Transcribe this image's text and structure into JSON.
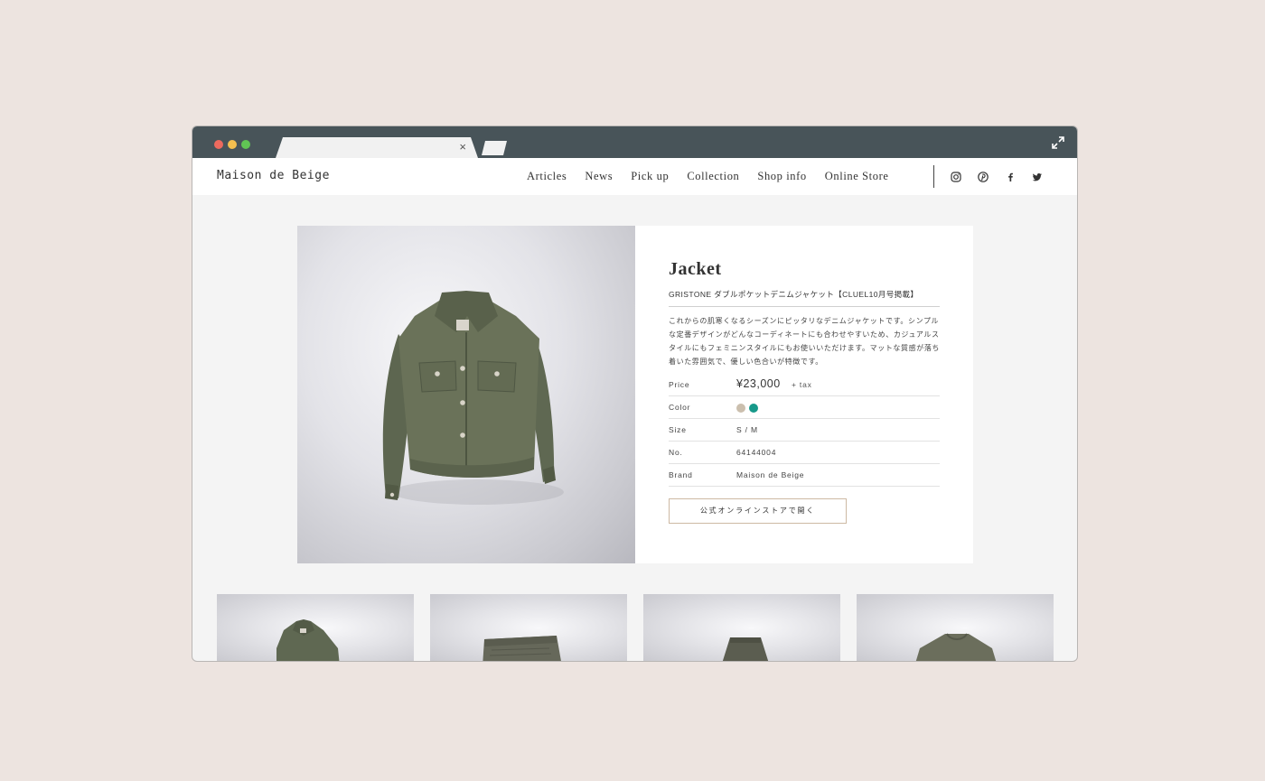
{
  "site": {
    "logo": "Maison de Beige",
    "nav": [
      "Articles",
      "News",
      "Pick up",
      "Collection",
      "Shop info",
      "Online Store"
    ],
    "social_icons": [
      "instagram-icon",
      "pinterest-icon",
      "facebook-icon",
      "twitter-icon"
    ]
  },
  "browser": {
    "tab_close": "×"
  },
  "product": {
    "title": "Jacket",
    "subtitle": "GRISTONE ダブルポケットデニムジャケット【CLUEL10月号掲載】",
    "description": "これからの肌寒くなるシーズンにピッタリなデニムジャケットです。シンプルな定番デザインがどんなコーディネートにも合わせやすいため、カジュアルスタイルにもフェミニンスタイルにもお使いいただけます。マットな質感が落ち着いた雰囲気で、優しい色合いが特徴です。",
    "specs": {
      "price_label": "Price",
      "price": "¥23,000",
      "tax": "+ tax",
      "color_label": "Color",
      "colors": [
        "#cbbfae",
        "#17998a"
      ],
      "size_label": "Size",
      "size": "S / M",
      "no_label": "No.",
      "no": "64144004",
      "brand_label": "Brand",
      "brand": "Maison de Beige"
    },
    "store_button": "公式オンラインストアで開く"
  },
  "colors": {
    "browser_chrome": "#485459",
    "page_background": "#ede4e0",
    "button_border": "#cdb9a3"
  }
}
